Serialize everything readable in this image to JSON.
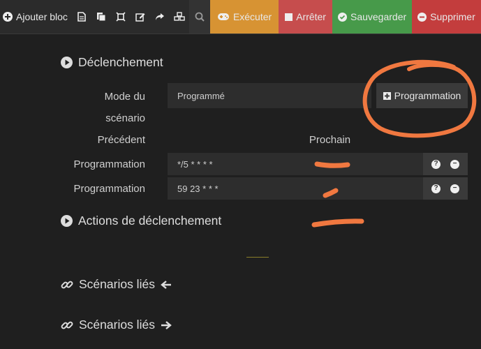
{
  "toolbar": {
    "add_block": "Ajouter bloc",
    "execute": "Exécuter",
    "stop": "Arrêter",
    "save": "Sauvegarder",
    "delete": "Supprimer"
  },
  "trigger": {
    "title": "Déclenchement",
    "mode_label": "Mode du scénario",
    "mode_value": "Programmé",
    "programming_button": "Programmation",
    "previous_label": "Précédent",
    "next_label": "Prochain",
    "rows": [
      {
        "label": "Programmation",
        "cron": "*/5 * * * *"
      },
      {
        "label": "Programmation",
        "cron": "59 23 * * *"
      }
    ]
  },
  "actions_title": "Actions de déclenchement",
  "linked1": "Scénarios liés",
  "linked2": "Scénarios liés",
  "colors": {
    "annotation": "#f07840",
    "execute": "#d79333",
    "stop": "#c64d4d",
    "save": "#479a4a",
    "delete": "#c33d3d"
  }
}
